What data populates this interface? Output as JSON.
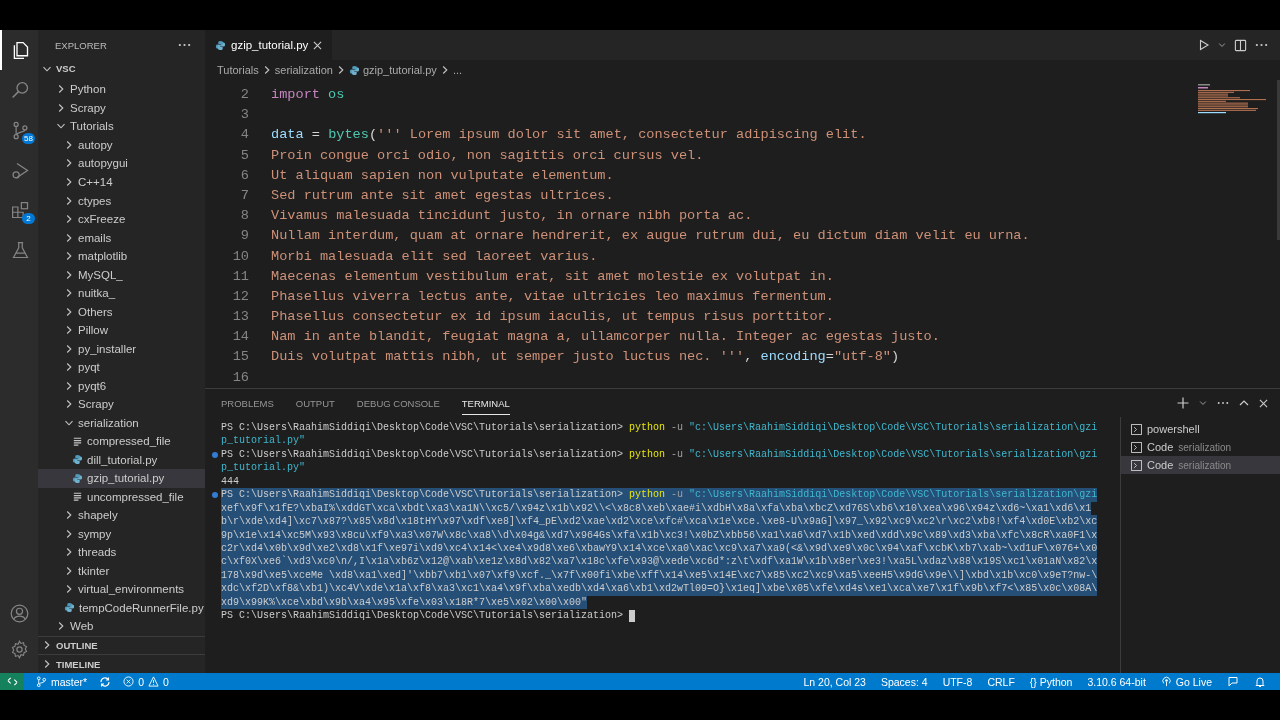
{
  "activity_bar": {
    "items": [
      {
        "kind": "explorer",
        "selected": true
      },
      {
        "kind": "search",
        "selected": false
      },
      {
        "kind": "source-control",
        "selected": false,
        "badge": "58"
      },
      {
        "kind": "run-debug",
        "selected": false
      },
      {
        "kind": "extensions",
        "selected": false,
        "badge": "2"
      },
      {
        "kind": "testing",
        "selected": false
      }
    ],
    "bottom": [
      {
        "kind": "account"
      },
      {
        "kind": "settings"
      }
    ]
  },
  "explorer": {
    "title": "EXPLORER",
    "root": {
      "label": "VSC",
      "kind": "folder",
      "expanded": true,
      "children": [
        {
          "label": "Python",
          "kind": "folder",
          "expanded": false,
          "selected": false
        },
        {
          "label": "Scrapy",
          "kind": "folder",
          "expanded": false,
          "selected": false
        },
        {
          "label": "Tutorials",
          "kind": "folder",
          "expanded": true,
          "selected": false,
          "children": [
            {
              "label": "autopy",
              "kind": "folder",
              "expanded": false,
              "selected": false
            },
            {
              "label": "autopygui",
              "kind": "folder",
              "expanded": false,
              "selected": false
            },
            {
              "label": "C++14",
              "kind": "folder",
              "expanded": false,
              "selected": false
            },
            {
              "label": "ctypes",
              "kind": "folder",
              "expanded": false,
              "selected": false
            },
            {
              "label": "cxFreeze",
              "kind": "folder",
              "expanded": false,
              "selected": false
            },
            {
              "label": "emails",
              "kind": "folder",
              "expanded": false,
              "selected": false
            },
            {
              "label": "matplotlib",
              "kind": "folder",
              "expanded": false,
              "selected": false
            },
            {
              "label": "MySQL_",
              "kind": "folder",
              "expanded": false,
              "selected": false
            },
            {
              "label": "nuitka_",
              "kind": "folder",
              "expanded": false,
              "selected": false
            },
            {
              "label": "Others",
              "kind": "folder",
              "expanded": false,
              "selected": false
            },
            {
              "label": "Pillow",
              "kind": "folder",
              "expanded": false,
              "selected": false
            },
            {
              "label": "py_installer",
              "kind": "folder",
              "expanded": false,
              "selected": false
            },
            {
              "label": "pyqt",
              "kind": "folder",
              "expanded": false,
              "selected": false
            },
            {
              "label": "pyqt6",
              "kind": "folder",
              "expanded": false,
              "selected": false
            },
            {
              "label": "Scrapy",
              "kind": "folder",
              "expanded": false,
              "selected": false
            },
            {
              "label": "serialization",
              "kind": "folder",
              "expanded": true,
              "selected": false,
              "children": [
                {
                  "label": "compressed_file",
                  "kind": "text",
                  "selected": false
                },
                {
                  "label": "dill_tutorial.py",
                  "kind": "python",
                  "selected": false
                },
                {
                  "label": "gzip_tutorial.py",
                  "kind": "python",
                  "selected": true
                },
                {
                  "label": "uncompressed_file",
                  "kind": "text",
                  "selected": false
                }
              ]
            },
            {
              "label": "shapely",
              "kind": "folder",
              "expanded": false,
              "selected": false
            },
            {
              "label": "sympy",
              "kind": "folder",
              "expanded": false,
              "selected": false
            },
            {
              "label": "threads",
              "kind": "folder",
              "expanded": false,
              "selected": false
            },
            {
              "label": "tkinter",
              "kind": "folder",
              "expanded": false,
              "selected": false
            },
            {
              "label": "virtual_environments",
              "kind": "folder",
              "expanded": false,
              "selected": false
            },
            {
              "label": "tempCodeRunnerFile.py",
              "kind": "python",
              "selected": false
            }
          ]
        },
        {
          "label": "Web",
          "kind": "folder",
          "expanded": false,
          "selected": false
        }
      ]
    },
    "sections": [
      {
        "label": "OUTLINE",
        "expanded": false
      },
      {
        "label": "TIMELINE",
        "expanded": false
      }
    ]
  },
  "tabs": [
    {
      "label": "gzip_tutorial.py",
      "kind": "python",
      "selected": true
    }
  ],
  "breadcrumb": [
    {
      "label": "Tutorials",
      "kind": "folder"
    },
    {
      "label": "serialization",
      "kind": "folder"
    },
    {
      "label": "gzip_tutorial.py",
      "kind": "python"
    },
    {
      "label": "...",
      "kind": "more"
    }
  ],
  "editor": {
    "lines": [
      {
        "number": "2",
        "tokens": [
          {
            "text": "import ",
            "kind": "keyword"
          },
          {
            "text": "os",
            "kind": "module"
          }
        ]
      },
      {
        "number": "3"
      },
      {
        "number": "4",
        "tokens": [
          {
            "text": "data",
            "kind": "variable"
          },
          {
            "text": " = ",
            "kind": "plain"
          },
          {
            "text": "bytes",
            "kind": "builtin"
          },
          {
            "text": "(",
            "kind": "plain"
          },
          {
            "text": "''' Lorem ipsum dolor sit amet, consectetur adipiscing elit.",
            "kind": "string"
          }
        ]
      },
      {
        "number": "5",
        "tokens": [
          {
            "text": "Proin congue orci odio, non sagittis orci cursus vel.",
            "kind": "string"
          }
        ]
      },
      {
        "number": "6",
        "tokens": [
          {
            "text": "Ut aliquam sapien non vulputate elementum.",
            "kind": "string"
          }
        ]
      },
      {
        "number": "7",
        "tokens": [
          {
            "text": "Sed rutrum ante sit amet egestas ultrices.",
            "kind": "string"
          }
        ]
      },
      {
        "number": "8",
        "tokens": [
          {
            "text": "Vivamus malesuada tincidunt justo, in ornare nibh porta ac.",
            "kind": "string"
          }
        ]
      },
      {
        "number": "9",
        "tokens": [
          {
            "text": "Nullam interdum, quam at ornare hendrerit, ex augue rutrum dui, eu dictum diam velit eu urna.",
            "kind": "string"
          }
        ]
      },
      {
        "number": "10",
        "tokens": [
          {
            "text": "Morbi malesuada elit sed laoreet varius.",
            "kind": "string"
          }
        ]
      },
      {
        "number": "11",
        "tokens": [
          {
            "text": "Maecenas elementum vestibulum erat, sit amet molestie ex volutpat in.",
            "kind": "string"
          }
        ]
      },
      {
        "number": "12",
        "tokens": [
          {
            "text": "Phasellus viverra lectus ante, vitae ultricies leo maximus fermentum.",
            "kind": "string"
          }
        ]
      },
      {
        "number": "13",
        "tokens": [
          {
            "text": "Phasellus consectetur ex id ipsum iaculis, ut tempus risus porttitor.",
            "kind": "string"
          }
        ]
      },
      {
        "number": "14",
        "tokens": [
          {
            "text": "Nam in ante blandit, feugiat magna a, ullamcorper nulla. Integer ac egestas justo.",
            "kind": "string"
          }
        ]
      },
      {
        "number": "15",
        "tokens": [
          {
            "text": "Duis volutpat mattis nibh, ut semper justo luctus nec. '''",
            "kind": "string"
          },
          {
            "text": ", ",
            "kind": "plain"
          },
          {
            "text": "encoding",
            "kind": "variable"
          },
          {
            "text": "=",
            "kind": "plain"
          },
          {
            "text": "\"utf-8\"",
            "kind": "string"
          },
          {
            "text": ")",
            "kind": "plain"
          }
        ]
      },
      {
        "number": "16"
      }
    ]
  },
  "panel": {
    "tabs": [
      {
        "label": "PROBLEMS",
        "selected": false
      },
      {
        "label": "OUTPUT",
        "selected": false
      },
      {
        "label": "DEBUG CONSOLE",
        "selected": false
      },
      {
        "label": "TERMINAL",
        "selected": true
      }
    ],
    "terminal": {
      "lines": [
        {
          "decorated": false,
          "selected": false,
          "segments": [
            {
              "text": "PS C:\\Users\\RaahimSiddiqi\\Desktop\\Code\\VSC\\Tutorials\\serialization> ",
              "kind": "plain"
            },
            {
              "text": "python",
              "kind": "command"
            },
            {
              "text": " -u ",
              "kind": "flag"
            },
            {
              "text": "\"c:\\Users\\RaahimSiddiqi\\Desktop\\Code\\VSC\\Tutorials\\serialization\\gzi",
              "kind": "string"
            }
          ]
        },
        {
          "decorated": false,
          "selected": false,
          "segments": [
            {
              "text": "p_tutorial.py\"",
              "kind": "string"
            }
          ]
        },
        {
          "decorated": true,
          "selected": false,
          "segments": [
            {
              "text": "PS C:\\Users\\RaahimSiddiqi\\Desktop\\Code\\VSC\\Tutorials\\serialization> ",
              "kind": "plain"
            },
            {
              "text": "python",
              "kind": "command"
            },
            {
              "text": " -u ",
              "kind": "flag"
            },
            {
              "text": "\"c:\\Users\\RaahimSiddiqi\\Desktop\\Code\\VSC\\Tutorials\\serialization\\gzi",
              "kind": "string"
            }
          ]
        },
        {
          "decorated": false,
          "selected": false,
          "segments": [
            {
              "text": "p_tutorial.py\"",
              "kind": "string"
            }
          ]
        },
        {
          "decorated": false,
          "selected": false,
          "segments": [
            {
              "text": "444",
              "kind": "plain"
            }
          ]
        },
        {
          "decorated": true,
          "selected": true,
          "segments": [
            {
              "text": "PS C:\\Users\\RaahimSiddiqi\\Desktop\\Code\\VSC\\Tutorials\\serialization> ",
              "kind": "plain"
            },
            {
              "text": "python",
              "kind": "command"
            },
            {
              "text": " -u ",
              "kind": "flag"
            },
            {
              "text": "\"c:\\Users\\RaahimSiddiqi\\Desktop\\Code\\VSC\\Tutorials\\serialization\\gzi",
              "kind": "string"
            }
          ]
        },
        {
          "decorated": false,
          "selected": true,
          "segments": [
            {
              "text": "xef\\x9f\\x1fE?\\xbaI%\\xddGT\\xca\\xbdt\\xa3\\xa1N\\\\xc5/\\x94z\\x1b\\x92\\\\<\\x8c8\\xeb\\xae#i\\xdbH\\x8a\\xfa\\xba\\xbcZ\\xd76S\\xb6\\x10\\xea\\x96\\x94z\\xd6~\\xa1\\xd6\\x1",
              "kind": "plain"
            }
          ]
        },
        {
          "decorated": false,
          "selected": true,
          "segments": [
            {
              "text": "b\\r\\xde\\xd4]\\xc7\\x87?\\x85\\x8d\\x18tHY\\x97\\xdf\\xe8]\\xf4_pE\\xd2\\xae\\xd2\\xce\\xfc#\\xca\\x1e\\xce.\\xe8-U\\x9aG]\\x97_\\x92\\xc9\\xc2\\r\\xc2\\xb8!\\xf4\\xd0E\\xb2\\xc",
              "kind": "plain"
            }
          ]
        },
        {
          "decorated": false,
          "selected": true,
          "segments": [
            {
              "text": "9p\\x1e\\x14\\xc5M\\x93\\x8cu\\xf9\\xa3\\x07W\\x8c\\xa8\\\\d\\x04g&\\xd7\\x964Gs\\xfa\\x1b\\xc3!\\x0bZ\\xbb56\\xa1\\xa6\\xd7\\x1b\\xed\\xdd\\x9c\\x89\\xd3\\xba\\xfc\\x8cR\\xa0F1\\x",
              "kind": "plain"
            }
          ]
        },
        {
          "decorated": false,
          "selected": true,
          "segments": [
            {
              "text": "c2r\\xd4\\x0b\\x9d\\xe2\\xd8\\x1f\\xe97i\\xd9\\xc4\\x14<\\xe4\\x9d8\\xe6\\xbawY9\\x14\\xce\\xa0\\xac\\xc9\\xa7\\xa9(<&\\x9d\\xe9\\x0c\\x94\\xaf\\xcbK\\xb7\\xab~\\xd1uF\\x076+\\x0",
              "kind": "plain"
            }
          ]
        },
        {
          "decorated": false,
          "selected": true,
          "segments": [
            {
              "text": "c\\xf0X\\xe6`\\xd3\\xc0\\n/,I\\x1a\\xb6z\\x12@\\xab\\xe1z\\x8d\\x82\\xa7\\x18c\\xfe\\x93@\\xede\\xc6d*:z\\t\\xdf\\xa1W\\x1b\\x8er\\xe3!\\xa5L\\xdaz\\x88\\x19S\\xc1\\x01aN\\x82\\x",
              "kind": "plain"
            }
          ]
        },
        {
          "decorated": false,
          "selected": true,
          "segments": [
            {
              "text": "178\\x9d\\xe5\\xceMe \\xd8\\xa1\\xed]'\\xbb7\\xb1\\x07\\xf9\\xcf._\\x7f\\x00fi\\xbe\\xff\\x14\\xe5\\x14E\\xc7\\x85\\xc2\\xc9\\xa5\\xeeH5\\x9dG\\x9e\\\\]\\xbd\\x1b\\xc0\\x9eT?nw-\\",
              "kind": "plain"
            }
          ]
        },
        {
          "decorated": false,
          "selected": true,
          "segments": [
            {
              "text": "xdc\\xf2D\\xf8&\\xb1)\\xc4V\\xde\\x1a\\xf8\\xa3\\xc1\\xa4\\x9f\\xba\\xedb\\xd4\\xa6\\xb1\\xd2wTl09=O}\\x1eq]\\xbe\\x05\\xfe\\xd4s\\xe1\\xca\\xe7\\x1f\\x9b\\xf7<\\x85\\x0c\\x08A\\",
              "kind": "plain"
            }
          ]
        },
        {
          "decorated": false,
          "selected": true,
          "segments": [
            {
              "text": "xd9\\x99K%\\xce\\xbd\\x9b\\xa4\\x95\\xfe\\x03\\x18R*7\\xe5\\x02\\x00\\x00\"",
              "kind": "plain"
            }
          ]
        },
        {
          "decorated": false,
          "selected": false,
          "cursor": true,
          "segments": [
            {
              "text": "PS C:\\Users\\RaahimSiddiqi\\Desktop\\Code\\VSC\\Tutorials\\serialization> ",
              "kind": "plain"
            }
          ]
        }
      ]
    },
    "terminals": [
      {
        "name": "powershell",
        "selected": false
      },
      {
        "name": "Code",
        "description": "serialization",
        "selected": false
      },
      {
        "name": "Code",
        "description": "serialization",
        "selected": true
      }
    ]
  },
  "status_bar": {
    "left": [
      {
        "kind": "remote"
      },
      {
        "kind": "branch",
        "text": "master*"
      },
      {
        "kind": "sync"
      },
      {
        "kind": "problems",
        "errors": "0",
        "warnings": "0"
      }
    ],
    "right": [
      {
        "kind": "text",
        "text": "Ln 20, Col 23"
      },
      {
        "kind": "text",
        "text": "Spaces: 4"
      },
      {
        "kind": "text",
        "text": "UTF-8"
      },
      {
        "kind": "text",
        "text": "CRLF"
      },
      {
        "kind": "language",
        "glyph": "{}",
        "text": "Python"
      },
      {
        "kind": "text",
        "text": "3.10.6 64-bit"
      },
      {
        "kind": "golive",
        "text": "Go Live"
      },
      {
        "kind": "feedback"
      },
      {
        "kind": "bell"
      }
    ]
  }
}
